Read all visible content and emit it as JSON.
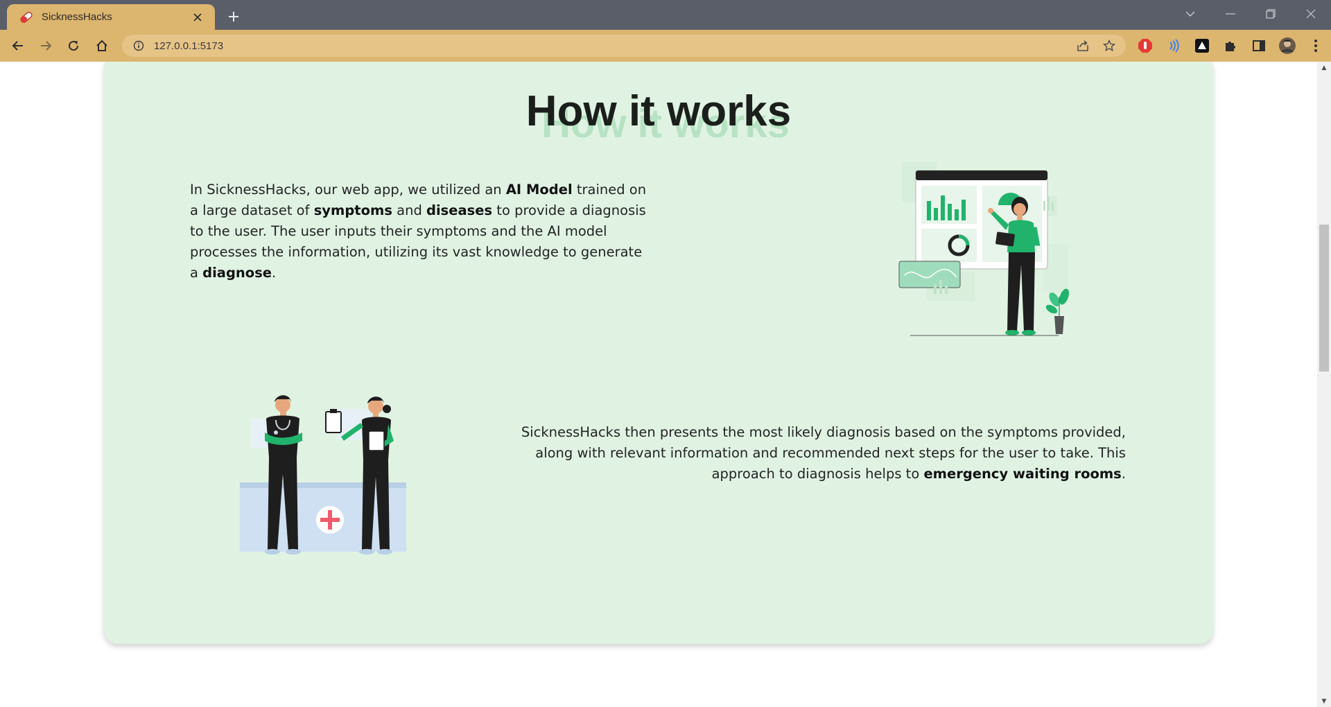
{
  "browser": {
    "tab_title": "SicknessHacks",
    "url": "127.0.0.1:5173",
    "icons": {
      "favicon": "pill-icon",
      "close": "close-icon",
      "new_tab": "plus-icon",
      "back": "back-arrow-icon",
      "forward": "forward-arrow-icon",
      "reload": "reload-icon",
      "home": "home-icon",
      "info": "info-icon",
      "share": "share-icon",
      "bookmark": "star-icon",
      "extensions": [
        "adblock-icon",
        "audio-extension-icon",
        "vercel-icon",
        "puzzle-icon",
        "sidebar-icon",
        "avatar",
        "kebab-menu-icon"
      ]
    }
  },
  "page": {
    "title": "How it works",
    "title_shadow": "How it works",
    "section1": {
      "p1": "In SicknessHacks, our web app, we utilized an ",
      "b1": "AI Model",
      "p2": " trained on a large dataset of ",
      "b2": "symptoms",
      "p3": " and ",
      "b3": "diseases",
      "p4": " to provide a diagnosis to the user. The user inputs their symptoms and the AI model processes the information, utilizing its vast knowledge to generate a ",
      "b4": "diagnose",
      "p5": "."
    },
    "section2": {
      "p1": "SicknessHacks then presents the most likely diagnosis based on the symptoms provided, along with relevant information and recommended next steps for the user to take. This approach to diagnosis helps to ",
      "b1": "emergency waiting rooms",
      "p2": "."
    }
  },
  "colors": {
    "card_bg": "#e0f3e3",
    "accent_green": "#21b36b",
    "tab_bg": "#dcb56f",
    "title_shadow": "#b7e2c3"
  }
}
